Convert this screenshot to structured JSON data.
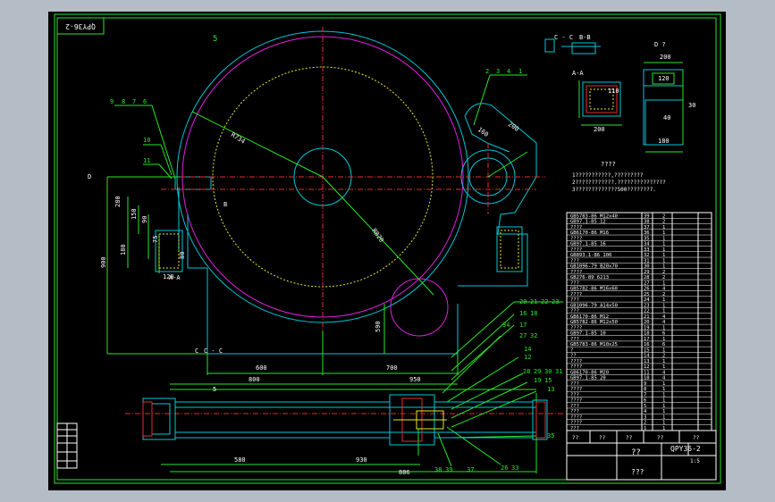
{
  "drawing": {
    "title_number": "QPY36-2",
    "top_left_stamp": "QPY36-2",
    "title_block": {
      "name": "??",
      "org": "???",
      "code": "QPY36-2",
      "scale": "1:5"
    },
    "notes": {
      "heading": "????",
      "lines": [
        "1???????????,?????????",
        "2????????????.???????????????",
        "3?????????????500????????."
      ]
    },
    "section_labels": {
      "a_a": "A-A",
      "b_b": "B-B",
      "c_c": "C - C",
      "d": "D",
      "d_view": "D ?",
      "a_marker": "A",
      "c_marker": "C",
      "b_marker": "B"
    },
    "balloons": [
      "5",
      "9",
      "8",
      "7",
      "6",
      "10",
      "11",
      "2",
      "3",
      "4",
      "1",
      "20",
      "21",
      "22",
      "23",
      "16",
      "18",
      "17",
      "34",
      "27",
      "32",
      "14",
      "12",
      "28",
      "29",
      "30",
      "31",
      "19",
      "15",
      "13",
      "35",
      "38",
      "39",
      "37",
      "26",
      "33"
    ],
    "dimensions": {
      "r734": "R734",
      "r820": "R820",
      "d280": "280",
      "d150": "150",
      "d90": "90",
      "d180": "180",
      "d120": "120",
      "d75": "75",
      "d80": "80",
      "d900": "900",
      "d590": "590",
      "d600": "600",
      "d700": "700",
      "d800": "800",
      "d950": "950",
      "d580": "580",
      "d930": "930",
      "d886": "886",
      "d200": "200",
      "d160": "160",
      "d30": "30",
      "d110": "110",
      "d40": "40",
      "d5": "5"
    },
    "bom_rows": [
      [
        "39",
        "GB5783-86  M12x40",
        "2"
      ],
      [
        "38",
        "GB97.1-85  12",
        "2"
      ],
      [
        "37",
        "????",
        "1"
      ],
      [
        "36",
        "GB6170-86  M16",
        "1"
      ],
      [
        "35",
        "????",
        "1"
      ],
      [
        "34",
        "GB97.1-85  16",
        "1"
      ],
      [
        "33",
        "????",
        "1"
      ],
      [
        "32",
        "GB893.1-86  100",
        "1"
      ],
      [
        "31",
        "???",
        "1"
      ],
      [
        "30",
        "GB1096-79  B20x70",
        "1"
      ],
      [
        "29",
        "????",
        "2"
      ],
      [
        "28",
        "GB276-89  6213",
        "2"
      ],
      [
        "27",
        "???",
        "1"
      ],
      [
        "26",
        "GB5782-86  M16x60",
        "4"
      ],
      [
        "25",
        "????",
        "2"
      ],
      [
        "24",
        "???",
        "1"
      ],
      [
        "23",
        "GB1096-79  A14x50",
        "1"
      ],
      [
        "22",
        "???",
        "1"
      ],
      [
        "21",
        "GB6170-86  M12",
        "4"
      ],
      [
        "20",
        "GB5782-86  M12x50",
        "4"
      ],
      [
        "19",
        "????",
        "1"
      ],
      [
        "18",
        "GB97.1-85  10",
        "6"
      ],
      [
        "17",
        "???",
        "1"
      ],
      [
        "16",
        "GB5783-86  M10x25",
        "6"
      ],
      [
        "15",
        "?",
        "1"
      ],
      [
        "14",
        "??",
        "2"
      ],
      [
        "13",
        "????",
        "1"
      ],
      [
        "12",
        "????",
        "1"
      ],
      [
        "11",
        "GB6170-86  M20",
        "4"
      ],
      [
        "10",
        "GB97.1-85  20",
        "4"
      ],
      [
        "9",
        "???",
        "1"
      ],
      [
        "8",
        "????",
        "1"
      ],
      [
        "7",
        "???",
        "1"
      ],
      [
        "6",
        "????",
        "1"
      ],
      [
        "5",
        "???",
        "1"
      ],
      [
        "4",
        "???",
        "1"
      ],
      [
        "3",
        "????",
        "1"
      ],
      [
        "2",
        "????",
        "1"
      ],
      [
        "1",
        "???",
        "1"
      ]
    ],
    "bom_header": [
      "??",
      "??",
      "??",
      "??",
      "??"
    ]
  }
}
